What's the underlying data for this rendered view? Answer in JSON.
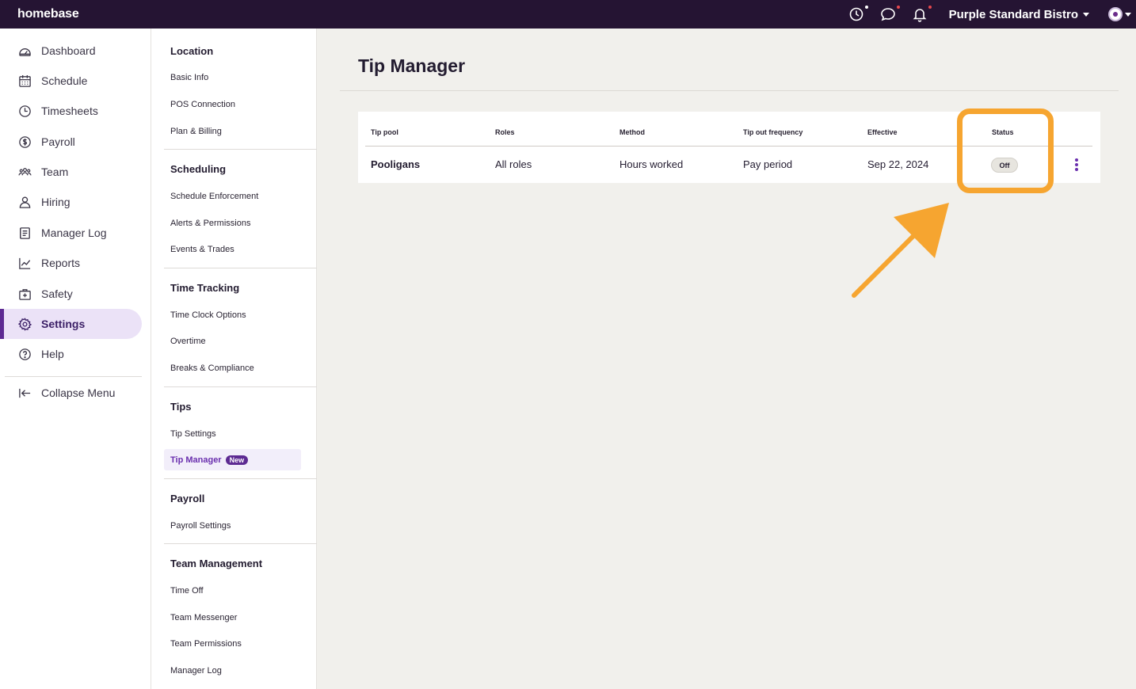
{
  "topbar": {
    "logo": "homebase",
    "org_name": "Purple Standard Bistro",
    "icons": [
      "clock-icon",
      "chat-icon",
      "bell-icon",
      "avatar-icon"
    ],
    "colors": {
      "background": "#251433",
      "dot_white": "#ffffff",
      "dot_red": "#e5484d"
    }
  },
  "leftnav": {
    "items": [
      {
        "label": "Dashboard",
        "icon": "dashboard-icon"
      },
      {
        "label": "Schedule",
        "icon": "calendar-icon"
      },
      {
        "label": "Timesheets",
        "icon": "clock-icon"
      },
      {
        "label": "Payroll",
        "icon": "dollar-icon"
      },
      {
        "label": "Team",
        "icon": "team-icon"
      },
      {
        "label": "Hiring",
        "icon": "person-icon"
      },
      {
        "label": "Manager Log",
        "icon": "log-icon"
      },
      {
        "label": "Reports",
        "icon": "chart-icon"
      },
      {
        "label": "Safety",
        "icon": "first-aid-icon"
      },
      {
        "label": "Settings",
        "icon": "gear-icon",
        "active": true
      },
      {
        "label": "Help",
        "icon": "help-icon"
      }
    ],
    "collapse_label": "Collapse Menu"
  },
  "subnav": {
    "sections": [
      {
        "title": "Location",
        "items": [
          "Basic Info",
          "POS Connection",
          "Plan & Billing"
        ]
      },
      {
        "title": "Scheduling",
        "items": [
          "Schedule Enforcement",
          "Alerts & Permissions",
          "Events & Trades"
        ]
      },
      {
        "title": "Time Tracking",
        "items": [
          "Time Clock Options",
          "Overtime",
          "Breaks & Compliance"
        ]
      },
      {
        "title": "Tips",
        "items": [
          "Tip Settings",
          "Tip Manager"
        ],
        "active_item": "Tip Manager",
        "badge": "New"
      },
      {
        "title": "Payroll",
        "items": [
          "Payroll Settings"
        ]
      },
      {
        "title": "Team Management",
        "items": [
          "Time Off",
          "Team Messenger",
          "Team Permissions",
          "Manager Log"
        ]
      }
    ]
  },
  "main": {
    "title": "Tip Manager",
    "table": {
      "headers": [
        "Tip pool",
        "Roles",
        "Method",
        "Tip out frequency",
        "Effective",
        "Status"
      ],
      "rows": [
        {
          "tip_pool": "Pooligans",
          "roles": "All roles",
          "method": "Hours worked",
          "frequency": "Pay period",
          "effective": "Sep 22, 2024",
          "status": "Off"
        }
      ]
    },
    "annotation_color": "#f6a530"
  }
}
